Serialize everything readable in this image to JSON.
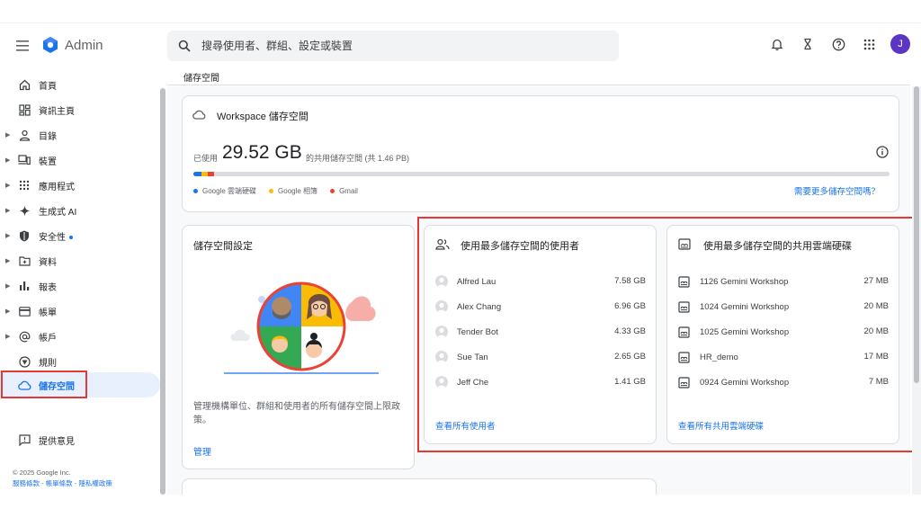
{
  "app": {
    "name": "Admin"
  },
  "search": {
    "placeholder": "搜尋使用者、群組、設定或裝置"
  },
  "user": {
    "avatar_initial": "J"
  },
  "sidebar": {
    "items": [
      {
        "label": "首頁",
        "icon": "home-icon",
        "caret": false
      },
      {
        "label": "資訊主頁",
        "icon": "dashboard-icon",
        "caret": false
      },
      {
        "label": "目錄",
        "icon": "person-icon",
        "caret": true
      },
      {
        "label": "裝置",
        "icon": "devices-icon",
        "caret": true
      },
      {
        "label": "應用程式",
        "icon": "apps-grid-icon",
        "caret": true
      },
      {
        "label": "生成式 AI",
        "icon": "sparkle-icon",
        "caret": true
      },
      {
        "label": "安全性",
        "icon": "shield-icon",
        "caret": true
      },
      {
        "label": "資料",
        "icon": "folder-icon",
        "caret": true
      },
      {
        "label": "報表",
        "icon": "bar-chart-icon",
        "caret": true
      },
      {
        "label": "帳單",
        "icon": "credit-card-icon",
        "caret": true
      },
      {
        "label": "帳戶",
        "icon": "at-sign-icon",
        "caret": true
      },
      {
        "label": "規則",
        "icon": "rules-icon",
        "caret": false
      },
      {
        "label": "儲存空間",
        "icon": "cloud-icon",
        "caret": false
      }
    ],
    "feedback": "提供意見",
    "copyright": "© 2025 Google Inc.",
    "footer_links": "服務條款 - 帳單條款 - 隱私權政策"
  },
  "breadcrumb": "儲存空間",
  "storage_card": {
    "title": "Workspace 儲存空間",
    "used_label": "已使用",
    "used_value": "29.52 GB",
    "used_suffix": "的共用儲存空間 (共 1.46 PB)",
    "usage_fractions": [
      0.012,
      0.009,
      0.009
    ],
    "legend": [
      {
        "label": "Google 雲端硬碟",
        "color": "#1a73e8"
      },
      {
        "label": "Google 相簿",
        "color": "#fbbc04"
      },
      {
        "label": "Gmail",
        "color": "#ea4335"
      }
    ],
    "need_more_link": "需要更多儲存空間嗎？"
  },
  "settings_card": {
    "title": "儲存空間設定",
    "description": "管理機構單位、群組和使用者的所有儲存空間上限政策。",
    "manage_link": "管理"
  },
  "top_users_card": {
    "title": "使用最多儲存空間的使用者",
    "rows": [
      {
        "name": "Alfred Lau",
        "value": "7.58 GB"
      },
      {
        "name": "Alex Chang",
        "value": "6.96 GB"
      },
      {
        "name": "Tender Bot",
        "value": "4.33 GB"
      },
      {
        "name": "Sue Tan",
        "value": "2.65 GB"
      },
      {
        "name": "Jeff Che",
        "value": "1.41 GB"
      }
    ],
    "view_all": "查看所有使用者"
  },
  "top_drives_card": {
    "title": "使用最多儲存空間的共用雲端硬碟",
    "rows": [
      {
        "name": "1126 Gemini Workshop",
        "value": "27 MB"
      },
      {
        "name": "1024 Gemini Workshop",
        "value": "20 MB"
      },
      {
        "name": "1025 Gemini Workshop",
        "value": "20 MB"
      },
      {
        "name": "HR_demo",
        "value": "17 MB"
      },
      {
        "name": "0924 Gemini Workshop",
        "value": "7 MB"
      }
    ],
    "view_all": "查看所有共用雲端硬碟"
  },
  "colors": {
    "accent": "#1a73e8",
    "highlight": "#e53935",
    "avatar": "#5c35c4"
  }
}
